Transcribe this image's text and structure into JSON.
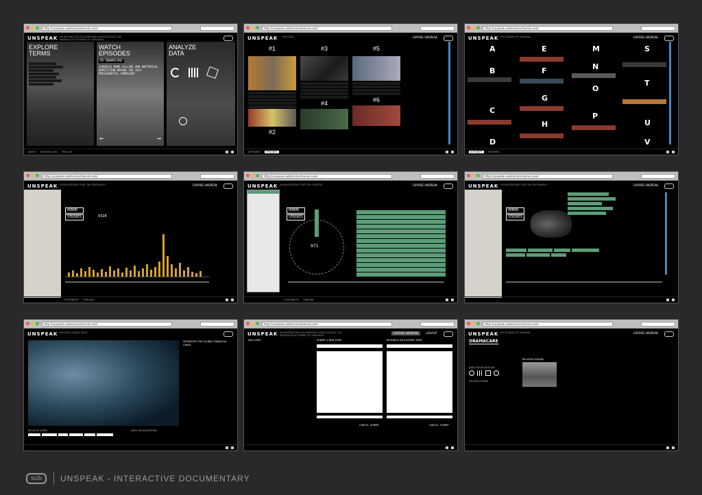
{
  "url": "http://unspeak.submarinechannel.com/",
  "brand": "UNSPEAK",
  "brand_glyph": "UNSPEAK",
  "sub_logo": "sub",
  "colors": {
    "bg": "#2b282c",
    "accent_green": "#5b9d78",
    "accent_gold": "#d4a331",
    "accent_blue": "#4a86c5",
    "accent_red": "#8a3a2e"
  },
  "footer": {
    "title": "UNSPEAK - INTERACTIVE DOCUMENTARY",
    "logo": "sub"
  },
  "home": {
    "tagline": "AN INTERACTIVE DOCUMENTARY INVESTIGATING THE MANIPULATIVE POWER OF LANGUAGE",
    "col1": {
      "title": "EXPLORE TERMS"
    },
    "col2": {
      "title": "WATCH EPISODES",
      "episode": "#5 OBAMACARE",
      "desc": "JUVENILE NAME-CALLING AND RHETORICAL REPETITION DURING THE 2012 PRESIDENTIAL CAMPAIGN?"
    },
    "col3": {
      "title": "ANALYZE DATA"
    },
    "foot": [
      "ABOUT",
      "MASTERCLASS",
      "PODCAST"
    ]
  },
  "episodes": {
    "header": "EPISODES",
    "btn": "EXPOSE UNSPEAK",
    "nums": [
      "#1",
      "#3",
      "#5",
      "#4",
      "#6",
      "#2"
    ],
    "foot": [
      "ALPHABET",
      "EPISODES"
    ]
  },
  "dictionary": {
    "header": "DICTIONARY OF UNSPEAK",
    "btn": "EXPOSE UNSPEAK",
    "letters": [
      "A",
      "E",
      "M",
      "S",
      "B",
      "F",
      "N",
      "T",
      "C",
      "G",
      "O",
      "U",
      "D",
      "H",
      "P",
      "V"
    ],
    "foot": [
      "ALPHABET",
      "EPISODES"
    ]
  },
  "frequency": {
    "header": "VISUALIZATIONS THAT TAG FREQUENCY",
    "term": [
      "HONOR",
      "STRIKES"
    ],
    "stat": "9328",
    "btn": "EXPOSE UNSPEAK",
    "foot": [
      "CONTRIBUTE",
      "TIMELINE"
    ]
  },
  "context": {
    "header": "VISUALIZATIONS THAT TAG CONTEXT",
    "term": [
      "HONOR",
      "STRIKES"
    ],
    "count": "971",
    "btn": "EXPOSE UNSPEAK",
    "foot": [
      "CONTRIBUTE",
      "TIMELINE"
    ]
  },
  "geo": {
    "header": "VISUALIZATIONS THAT TAG GEOGRAPHY",
    "term": [
      "HONOR",
      "STRIKES"
    ],
    "btn": "EXPOSE UNSPEAK"
  },
  "video": {
    "header": "EPISODE: GRAND TALES",
    "side_title": "SPONSORS THE GLOBAL FINANCIAL CRISIS",
    "related": "RELATED TERMS",
    "data_vis": "DATA VISUALIZATIONS"
  },
  "submit": {
    "welcome": "WELCOME",
    "new_term": "SUBMIT A NEW TERM",
    "existing": "RESEARCH AN EXISTING TERM",
    "btn1": "EXPOSE UNSPEAK",
    "btn2": "LOGOUT",
    "cancel": "CANCEL",
    "submit": "SUBMIT"
  },
  "term": {
    "header": "DICTIONARY OF UNSPEAK",
    "title": "OBAMACARE",
    "data_vis": "DATA VISUALIZATIONS",
    "related": "RELATED TERMS",
    "related_ep": "RELATED EPISODE",
    "btn": "EXPOSE UNSPEAK",
    "btn2": "EPISODES"
  }
}
